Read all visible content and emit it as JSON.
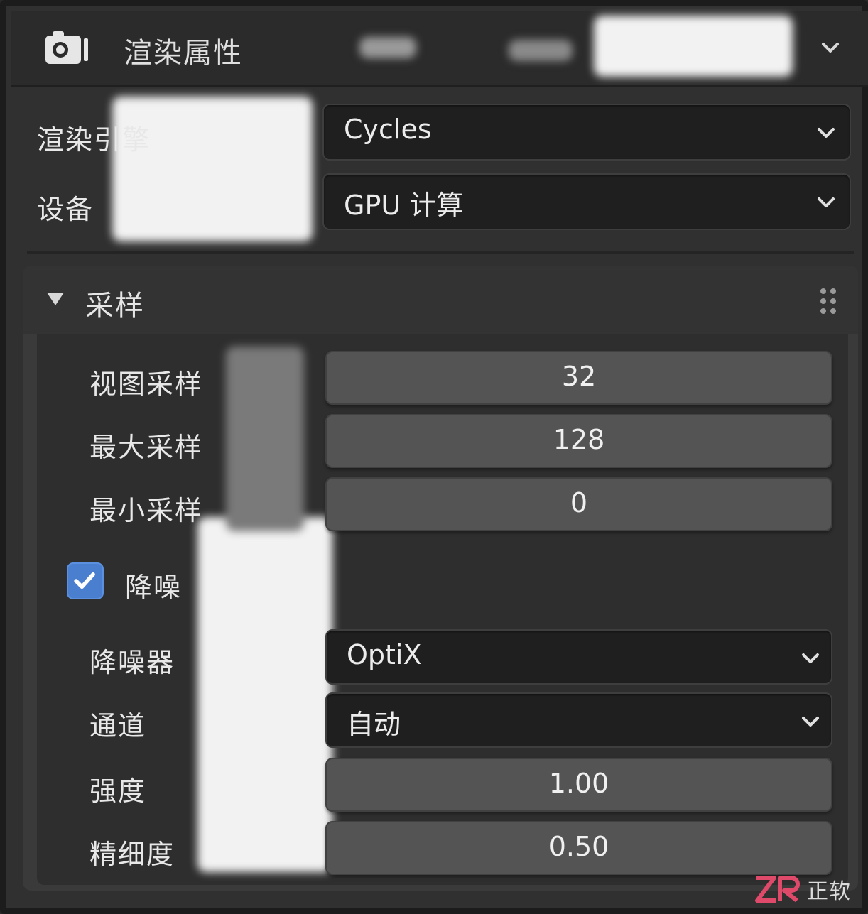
{
  "header": {
    "title": "渲染属性"
  },
  "render": {
    "engine_label": "渲染引擎",
    "engine_value": "Cycles",
    "device_label": "设备",
    "device_value": "GPU 计算"
  },
  "sampling": {
    "title": "采样",
    "viewport_label": "视图采样",
    "viewport_value": "32",
    "max_label": "最大采样",
    "max_value": "128",
    "min_label": "最小采样",
    "min_value": "0",
    "denoise_label": "降噪",
    "denoise_checked": true,
    "denoiser_label": "降噪器",
    "denoiser_value": "OptiX",
    "passes_label": "通道",
    "passes_value": "自动",
    "strength_label": "强度",
    "strength_value": "1.00",
    "detail_label": "精细度",
    "detail_value": "0.50"
  },
  "watermark": {
    "text": "正软"
  },
  "colors": {
    "accent": "#4a7fd0",
    "panel": "#303030",
    "field_dark": "#1f1f1f",
    "field_num": "#545454"
  }
}
